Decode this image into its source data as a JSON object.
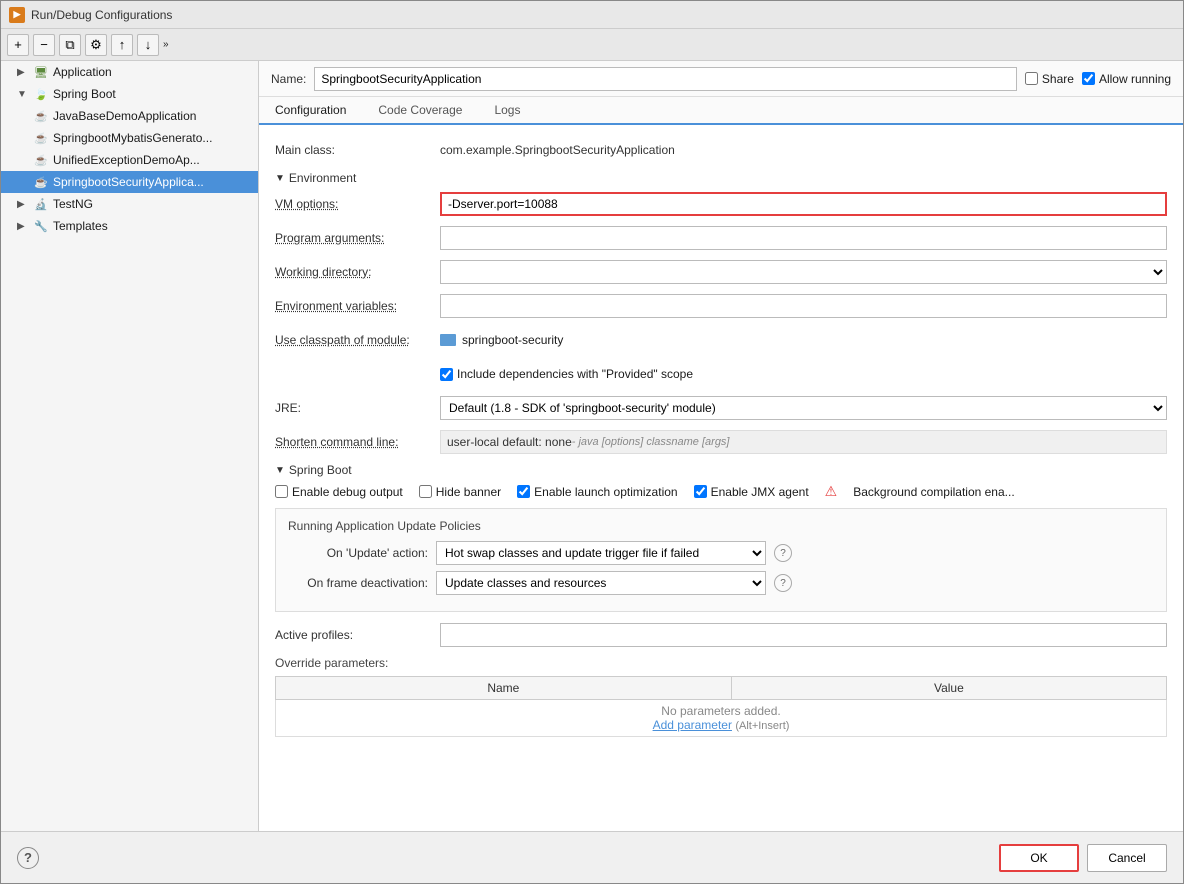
{
  "window": {
    "title": "Run/Debug Configurations"
  },
  "toolbar": {
    "add_label": "+",
    "remove_label": "−",
    "copy_label": "⧉",
    "settings_label": "⚙",
    "up_label": "↑",
    "down_label": "↓",
    "more_label": "»"
  },
  "sidebar": {
    "items": [
      {
        "id": "application",
        "label": "Application",
        "level": 0,
        "expanded": true,
        "icon": "app"
      },
      {
        "id": "spring-boot",
        "label": "Spring Boot",
        "level": 0,
        "expanded": true,
        "icon": "spring"
      },
      {
        "id": "java1",
        "label": "JavaBaseDemoApplication",
        "level": 1,
        "icon": "java"
      },
      {
        "id": "java2",
        "label": "SpringbootMybatisGenerato...",
        "level": 1,
        "icon": "java"
      },
      {
        "id": "java3",
        "label": "UnifiedExceptionDemoAp...",
        "level": 1,
        "icon": "java"
      },
      {
        "id": "java4",
        "label": "SpringbootSecurityApplica...",
        "level": 1,
        "icon": "java",
        "selected": true
      },
      {
        "id": "testng",
        "label": "TestNG",
        "level": 0,
        "expanded": false,
        "icon": "testng"
      },
      {
        "id": "templates",
        "label": "Templates",
        "level": 0,
        "expanded": false,
        "icon": "templates"
      }
    ]
  },
  "name_bar": {
    "label": "Name:",
    "value": "SpringbootSecurityApplication",
    "share_label": "Share",
    "allow_running_label": "Allow running"
  },
  "tabs": [
    {
      "id": "configuration",
      "label": "Configuration",
      "active": true
    },
    {
      "id": "code-coverage",
      "label": "Code Coverage",
      "active": false
    },
    {
      "id": "logs",
      "label": "Logs",
      "active": false
    }
  ],
  "form": {
    "main_class_label": "Main class:",
    "main_class_value": "com.example.SpringbootSecurityApplication",
    "environment_label": "Environment",
    "vm_options_label": "VM options:",
    "vm_options_value": "-Dserver.port=10088",
    "program_args_label": "Program arguments:",
    "working_dir_label": "Working directory:",
    "env_vars_label": "Environment variables:",
    "classpath_label": "Use classpath of module:",
    "classpath_value": "springboot-security",
    "include_deps_label": "Include dependencies with \"Provided\" scope",
    "jre_label": "JRE:",
    "jre_value": "Default (1.8 - SDK of 'springboot-security' module)",
    "shorten_label": "Shorten command line:",
    "shorten_value": "user-local default: none",
    "shorten_hint": " - java [options] classname [args]"
  },
  "spring_boot": {
    "section_label": "Spring Boot",
    "debug_output_label": "Enable debug output",
    "hide_banner_label": "Hide banner",
    "launch_opt_label": "Enable launch optimization",
    "jmx_label": "Enable JMX agent",
    "bg_compile_label": "Background compilation ena...",
    "debug_output_checked": false,
    "hide_banner_checked": false,
    "launch_opt_checked": true,
    "jmx_checked": true
  },
  "update_policies": {
    "title": "Running Application Update Policies",
    "update_label": "On 'Update' action:",
    "update_value": "Hot swap classes and update trigger file if failed",
    "frame_label": "On frame deactivation:",
    "frame_value": "Update classes and resources"
  },
  "profiles": {
    "label": "Active profiles:"
  },
  "override": {
    "title": "Override parameters:",
    "columns": [
      "Name",
      "Value"
    ],
    "empty_text": "No parameters added.",
    "add_label": "Add parameter",
    "add_shortcut": "(Alt+Insert)"
  },
  "buttons": {
    "ok_label": "OK",
    "cancel_label": "Cancel"
  }
}
